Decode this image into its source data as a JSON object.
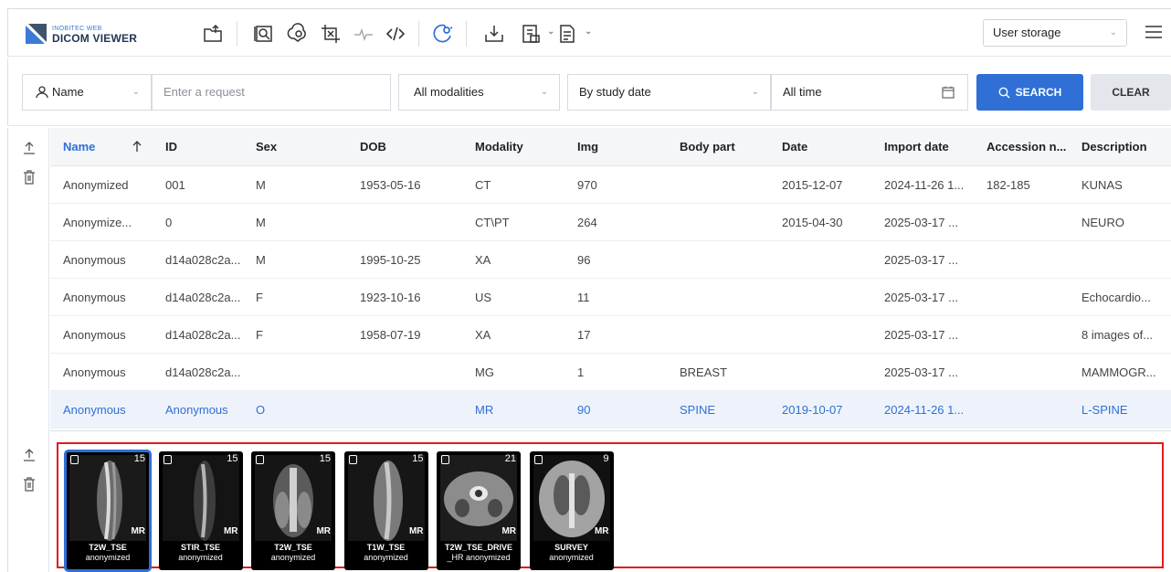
{
  "app": {
    "brand_small": "INOBITEC WEB",
    "brand_main": "DICOM VIEWER",
    "storage_label": "User storage",
    "accent": "#2f6fd6",
    "highlight_border": "#e01b1b"
  },
  "toolbar_icons": [
    "upload-folder-icon",
    "image-viewer-icon",
    "brain-icon",
    "crop-layers-icon",
    "ecg-icon",
    "code-icon",
    "settings-search-icon",
    "download-icon",
    "report-icon",
    "document-icon"
  ],
  "filters": {
    "field_label": "Name",
    "request_placeholder": "Enter a request",
    "modalities": "All modalities",
    "date_mode": "By study date",
    "time_range": "All time",
    "search_label": "SEARCH",
    "clear_label": "CLEAR"
  },
  "table": {
    "columns": [
      "Name",
      "ID",
      "Sex",
      "DOB",
      "Modality",
      "Img",
      "Body part",
      "Date",
      "Import date",
      "Accession n...",
      "Description"
    ],
    "rows": [
      [
        "Anonymized",
        "001",
        "M",
        "1953-05-16",
        "CT",
        "970",
        "",
        "2015-12-07",
        "2024-11-26 1...",
        "182-185",
        "KUNAS"
      ],
      [
        "Anonymize...",
        "0",
        "M",
        "",
        "CT\\PT",
        "264",
        "",
        "2015-04-30",
        "2025-03-17 ...",
        "",
        "NEURO"
      ],
      [
        "Anonymous",
        "d14a028c2a...",
        "M",
        "1995-10-25",
        "XA",
        "96",
        "",
        "",
        "2025-03-17 ...",
        "",
        ""
      ],
      [
        "Anonymous",
        "d14a028c2a...",
        "F",
        "1923-10-16",
        "US",
        "11",
        "",
        "",
        "2025-03-17 ...",
        "",
        "Echocardio..."
      ],
      [
        "Anonymous",
        "d14a028c2a...",
        "F",
        "1958-07-19",
        "XA",
        "17",
        "",
        "",
        "2025-03-17 ...",
        "",
        "8 images of..."
      ],
      [
        "Anonymous",
        "d14a028c2a...",
        "",
        "",
        "MG",
        "1",
        "BREAST",
        "",
        "2025-03-17 ...",
        "",
        "MAMMOGR..."
      ],
      [
        "Anonymous",
        "Anonymous",
        "O",
        "",
        "MR",
        "90",
        "SPINE",
        "2019-10-07",
        "2024-11-26 1...",
        "",
        "L-SPINE"
      ]
    ],
    "selected_row": 6
  },
  "series": [
    {
      "name": "T2W_TSE",
      "sub": "anonymized",
      "count": "15",
      "modality": "MR"
    },
    {
      "name": "STIR_TSE",
      "sub": "anonymized",
      "count": "15",
      "modality": "MR"
    },
    {
      "name": "T2W_TSE",
      "sub": "anonymized",
      "count": "15",
      "modality": "MR"
    },
    {
      "name": "T1W_TSE",
      "sub": "anonymized",
      "count": "15",
      "modality": "MR"
    },
    {
      "name": "T2W_TSE_DRIVE",
      "sub": "_HR anonymized",
      "count": "21",
      "modality": "MR"
    },
    {
      "name": "SURVEY",
      "sub": "anonymized",
      "count": "9",
      "modality": "MR"
    }
  ]
}
